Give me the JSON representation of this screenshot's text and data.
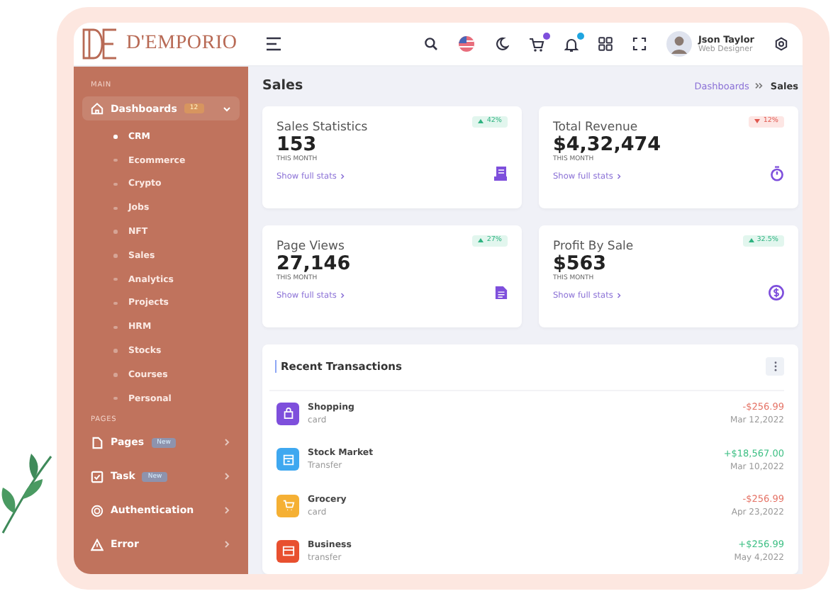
{
  "brand": {
    "name": "D'EMPORIO"
  },
  "header": {
    "user": {
      "name": "Json Taylor",
      "role": "Web Designer"
    }
  },
  "sidebar": {
    "sections": [
      {
        "title": "MAIN",
        "items": [
          {
            "label": "Dashboards",
            "badge": "12",
            "expanded": true,
            "children": [
              {
                "label": "CRM",
                "selected": true
              },
              {
                "label": "Ecommerce",
                "selected": false
              },
              {
                "label": "Crypto",
                "selected": false
              },
              {
                "label": "Jobs",
                "selected": false
              },
              {
                "label": "NFT",
                "selected": false
              },
              {
                "label": "Sales",
                "selected": false
              },
              {
                "label": "Analytics",
                "selected": false
              },
              {
                "label": "Projects",
                "selected": false
              },
              {
                "label": "HRM",
                "selected": false
              },
              {
                "label": "Stocks",
                "selected": false
              },
              {
                "label": "Courses",
                "selected": false
              },
              {
                "label": "Personal",
                "selected": false
              }
            ]
          }
        ]
      },
      {
        "title": "PAGES",
        "items": [
          {
            "label": "Pages",
            "badge": "New",
            "expanded": false
          },
          {
            "label": "Task",
            "badge": "New",
            "expanded": false
          },
          {
            "label": "Authentication",
            "expanded": false
          },
          {
            "label": "Error",
            "expanded": false
          }
        ]
      }
    ]
  },
  "page": {
    "title": "Sales",
    "breadcrumb": [
      "Dashboards",
      "Sales"
    ]
  },
  "stats": [
    {
      "title": "Sales Statistics",
      "value": "153",
      "period": "THIS MONTH",
      "link": "Show full stats",
      "trend": "42%",
      "kind": "up"
    },
    {
      "title": "Total Revenue",
      "value": "$4,32,474",
      "period": "THIS MONTH",
      "link": "Show full stats",
      "trend": "12%",
      "kind": "down"
    },
    {
      "title": "Page Views",
      "value": "27,146",
      "period": "THIS MONTH",
      "link": "Show full stats",
      "trend": "27%",
      "kind": "up"
    },
    {
      "title": "Profit By Sale",
      "value": "$563",
      "period": "THIS MONTH",
      "link": "Show full stats",
      "trend": "32.5%",
      "kind": "up"
    }
  ],
  "transactions": {
    "title": "Recent Transactions",
    "rows": [
      {
        "name": "Shopping",
        "method": "card",
        "amount": "-$256.99",
        "date": "Mar 12,2022",
        "kind": "debit",
        "color": "#7e4fdc"
      },
      {
        "name": "Stock Market",
        "method": "Transfer",
        "amount": "+$18,567.00",
        "date": "Mar 10,2022",
        "kind": "credit",
        "color": "#3fa8f0"
      },
      {
        "name": "Grocery",
        "method": "card",
        "amount": "-$256.99",
        "date": "Apr 23,2022",
        "kind": "debit",
        "color": "#f5b034"
      },
      {
        "name": "Business",
        "method": "transfer",
        "amount": "+$256.99",
        "date": "May 4,2022",
        "kind": "credit",
        "color": "#e8502f"
      }
    ]
  }
}
